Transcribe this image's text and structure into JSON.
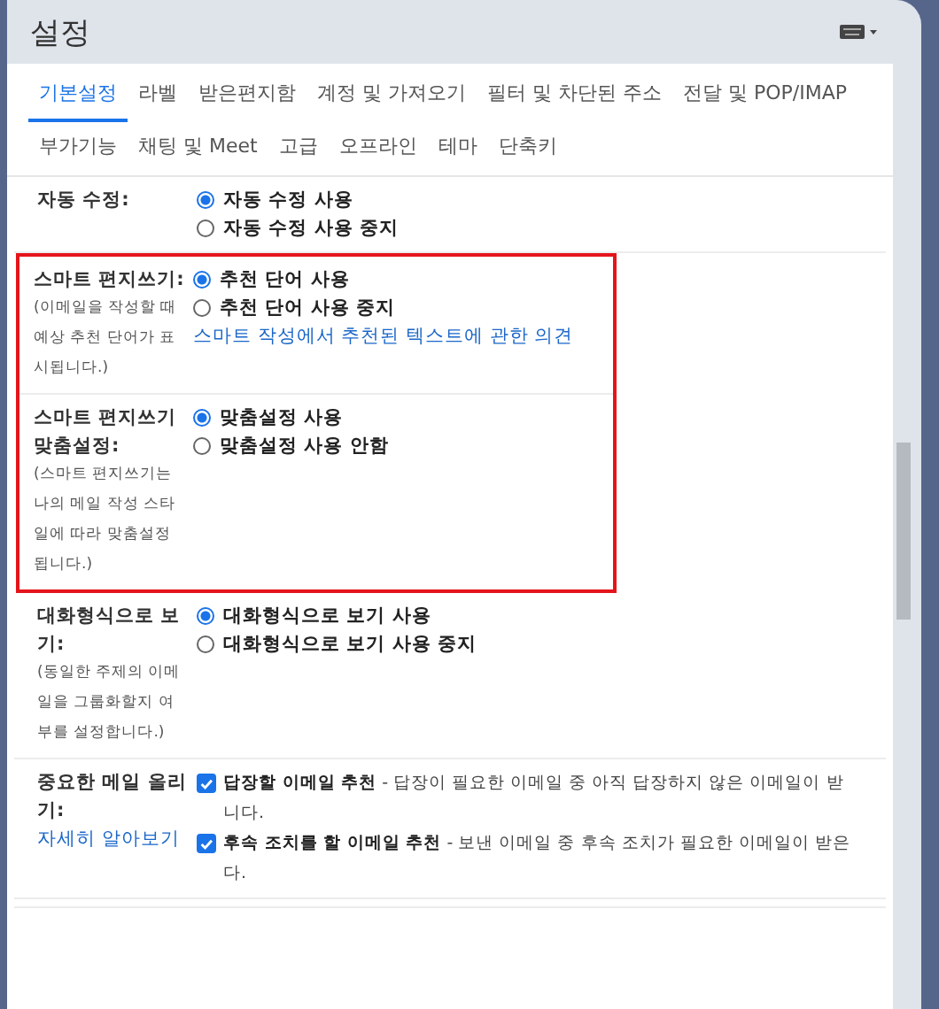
{
  "header": {
    "title": "설정"
  },
  "tabs": [
    [
      {
        "label": "기본설정",
        "selected": true
      },
      {
        "label": "라벨",
        "selected": false
      },
      {
        "label": "받은편지함",
        "selected": false
      },
      {
        "label": "계정 및 가져오기",
        "selected": false
      },
      {
        "label": "필터 및 차단된 주소",
        "selected": false
      },
      {
        "label": "전달 및 POP/IMAP",
        "selected": false
      }
    ],
    [
      {
        "label": "부가기능",
        "selected": false
      },
      {
        "label": "채팅 및 Meet",
        "selected": false
      },
      {
        "label": "고급",
        "selected": false
      },
      {
        "label": "오프라인",
        "selected": false
      },
      {
        "label": "테마",
        "selected": false
      },
      {
        "label": "단축키",
        "selected": false
      }
    ]
  ],
  "settings": [
    {
      "kind": "radio",
      "label": "자동 수정:",
      "highlighted": false,
      "options": [
        {
          "label": "자동 수정 사용",
          "selected": true
        },
        {
          "label": "자동 수정 사용 중지",
          "selected": false
        }
      ]
    },
    {
      "kind": "radio",
      "label": "스마트 편지쓰기:",
      "description": "(이메일을 작성할 때 예상 추천 단어가 표시됩니다.)",
      "highlighted": true,
      "options": [
        {
          "label": "추천 단어 사용",
          "selected": true
        },
        {
          "label": "추천 단어 사용 중지",
          "selected": false
        }
      ],
      "link": "스마트 작성에서 추천된 텍스트에 관한 의견"
    },
    {
      "kind": "radio",
      "label": "스마트 편지쓰기 맞춤설정:",
      "description": "(스마트 편지쓰기는 나의 메일 작성 스타일에 따라 맞춤설정됩니다.)",
      "highlighted": true,
      "options": [
        {
          "label": "맞춤설정 사용",
          "selected": true
        },
        {
          "label": "맞춤설정 사용 안함",
          "selected": false
        }
      ]
    },
    {
      "kind": "radio",
      "label": "대화형식으로 보기:",
      "description": "(동일한 주제의 이메일을 그룹화할지 여부를 설정합니다.)",
      "highlighted": false,
      "options": [
        {
          "label": "대화형식으로 보기 사용",
          "selected": true
        },
        {
          "label": "대화형식으로 보기 사용 중지",
          "selected": false
        }
      ]
    },
    {
      "kind": "checkbox",
      "label": "중요한 메일 올리기:",
      "label_link": "자세히 알아보기",
      "highlighted": false,
      "options": [
        {
          "title": "답장할 이메일 추천",
          "text": " - 답장이 필요한 이메일 중 아직 답장하지 않은 이메일이 받",
          "continuation": "니다.",
          "checked": true
        },
        {
          "title": "후속 조치를 할 이메일 추천",
          "text": " - 보낸 이메일 중 후속 조치가 필요한 이메일이 받은",
          "continuation": "다.",
          "checked": true
        }
      ]
    }
  ]
}
